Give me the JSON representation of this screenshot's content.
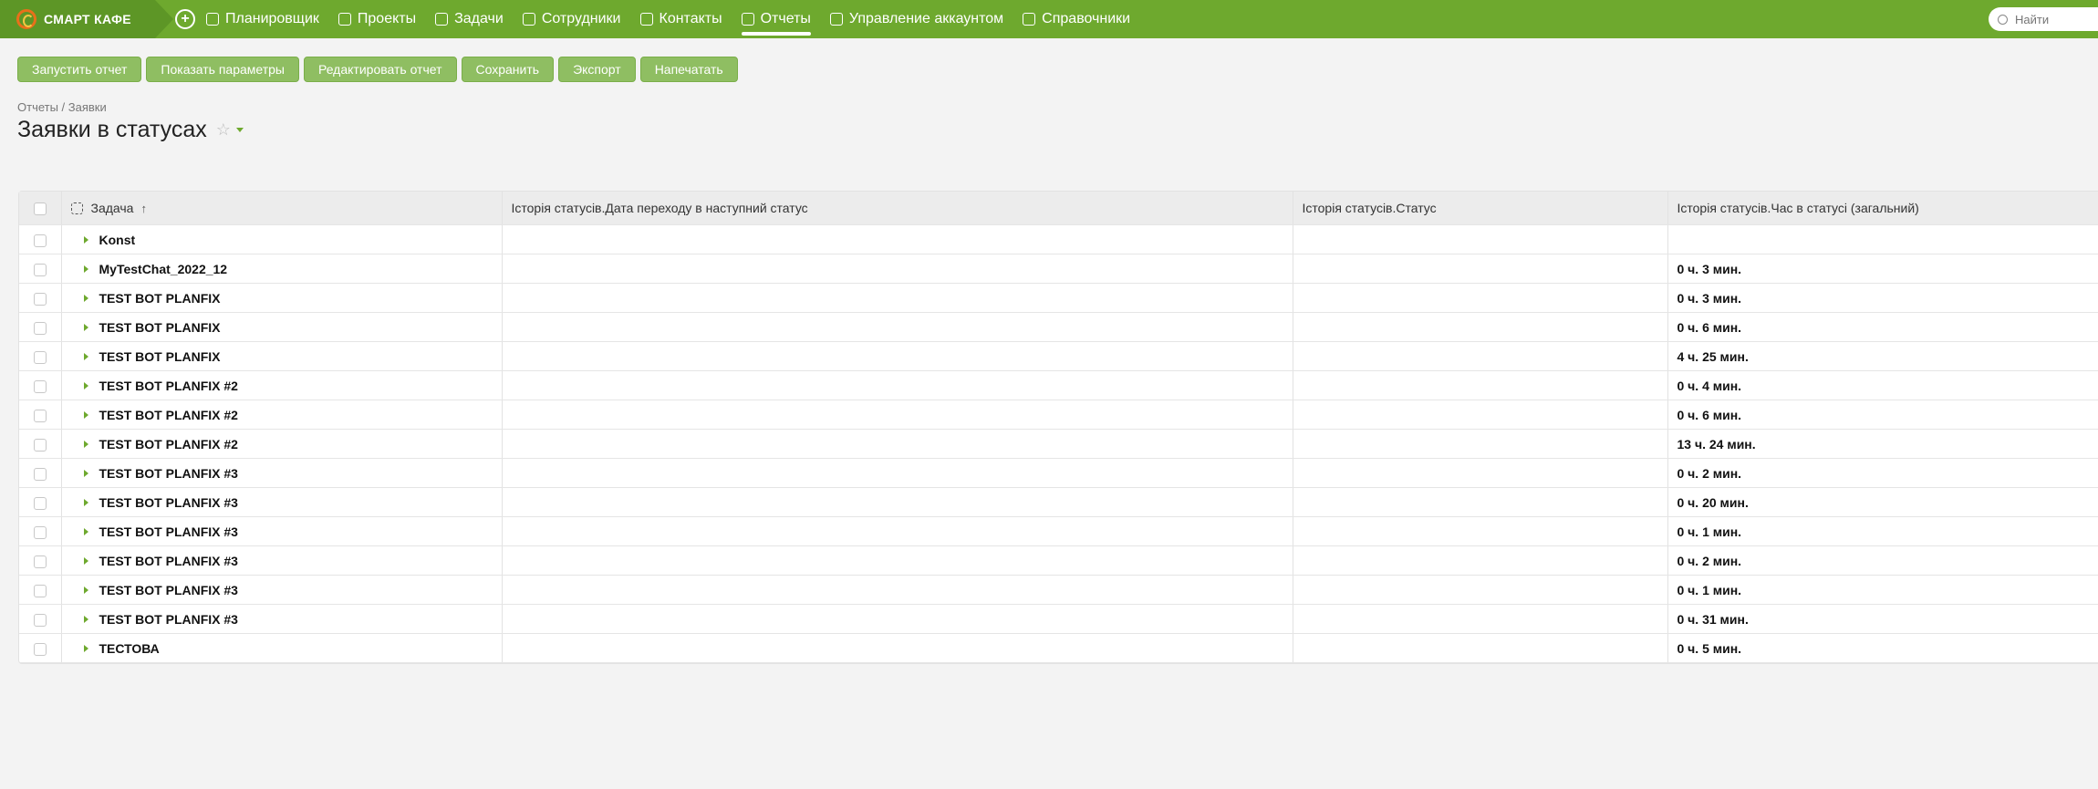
{
  "app": {
    "logo_text": "СМАРТ КАФЕ"
  },
  "nav": {
    "items": [
      {
        "label": "Планировщик",
        "icon": "planner-icon"
      },
      {
        "label": "Проекты",
        "icon": "projects-icon"
      },
      {
        "label": "Задачи",
        "icon": "tasks-icon"
      },
      {
        "label": "Сотрудники",
        "icon": "employees-icon"
      },
      {
        "label": "Контакты",
        "icon": "contacts-icon"
      },
      {
        "label": "Отчеты",
        "icon": "reports-icon",
        "active": true
      },
      {
        "label": "Управление аккаунтом",
        "icon": "account-icon"
      },
      {
        "label": "Справочники",
        "icon": "directory-icon"
      }
    ]
  },
  "search": {
    "placeholder": "Найти"
  },
  "toolbar": {
    "run": "Запустить отчет",
    "params": "Показать параметры",
    "edit": "Редактировать отчет",
    "save": "Сохранить",
    "export": "Экспорт",
    "print": "Напечатать"
  },
  "breadcrumb": "Отчеты / Заявки",
  "page_title": "Заявки в статусах",
  "table": {
    "headers": {
      "task": "Задача",
      "date": "Історія статусів.Дата переходу в наступний статус",
      "status": "Історія статусів.Статус",
      "time": "Історія статусів.Час в статусі (загальний)"
    },
    "rows": [
      {
        "task": "Konst",
        "time": ""
      },
      {
        "task": "MyTestChat_2022_12",
        "time": "0 ч. 3 мин."
      },
      {
        "task": "TEST BOT PLANFIX",
        "time": "0 ч. 3 мин."
      },
      {
        "task": "TEST BOT PLANFIX",
        "time": "0 ч. 6 мин."
      },
      {
        "task": "TEST BOT PLANFIX",
        "time": "4 ч. 25 мин."
      },
      {
        "task": "TEST BOT PLANFIX #2",
        "time": "0 ч. 4 мин."
      },
      {
        "task": "TEST BOT PLANFIX #2",
        "time": "0 ч. 6 мин."
      },
      {
        "task": "TEST BOT PLANFIX #2",
        "time": "13 ч. 24 мин."
      },
      {
        "task": "TEST BOT PLANFIX #3",
        "time": "0 ч. 2 мин."
      },
      {
        "task": "TEST BOT PLANFIX #3",
        "time": "0 ч. 20 мин."
      },
      {
        "task": "TEST BOT PLANFIX #3",
        "time": "0 ч. 1 мин."
      },
      {
        "task": "TEST BOT PLANFIX #3",
        "time": "0 ч. 2 мин."
      },
      {
        "task": "TEST BOT PLANFIX #3",
        "time": "0 ч. 1 мин."
      },
      {
        "task": "TEST BOT PLANFIX #3",
        "time": "0 ч. 31 мин."
      },
      {
        "task": "ТЕСТОВА",
        "time": "0 ч. 5 мин."
      }
    ]
  },
  "colors": {
    "brand": "#6ea92e",
    "button": "#8fbe62"
  }
}
